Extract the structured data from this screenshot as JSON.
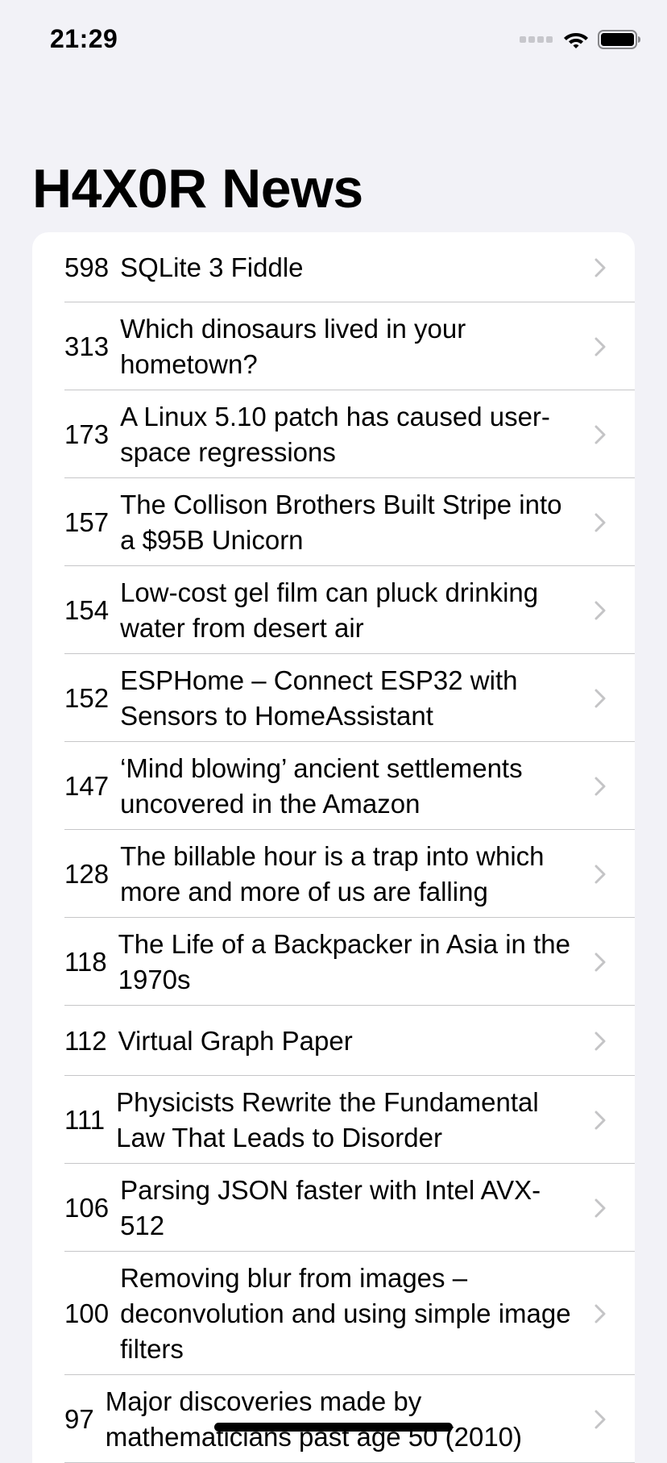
{
  "status_bar": {
    "time": "21:29"
  },
  "nav": {
    "title": "H4X0R News"
  },
  "colors": {
    "background": "#f2f2f7",
    "list_background": "#ffffff",
    "separator": "#c6c6c8",
    "chevron": "#c4c4c6",
    "text": "#000000"
  },
  "icons": {
    "row_disclosure": "chevron-right-icon",
    "status": [
      "cellular-signal-icon",
      "wifi-icon",
      "battery-icon"
    ]
  },
  "stories": [
    {
      "score": "598",
      "title": "SQLite 3 Fiddle",
      "lines": 1
    },
    {
      "score": "313",
      "title": "Which dinosaurs lived in your hometown?",
      "lines": 2
    },
    {
      "score": "173",
      "title": "A Linux 5.10 patch has caused user-space regressions",
      "lines": 2
    },
    {
      "score": "157",
      "title": "The Collison Brothers Built Stripe into a $95B Unicorn",
      "lines": 2
    },
    {
      "score": "154",
      "title": "Low-cost gel film can pluck drinking water from desert air",
      "lines": 2
    },
    {
      "score": "152",
      "title": "ESPHome – Connect ESP32 with Sensors to HomeAssistant",
      "lines": 2
    },
    {
      "score": "147",
      "title": "‘Mind blowing’ ancient settlements uncovered in the Amazon",
      "lines": 2
    },
    {
      "score": "128",
      "title": "The billable hour is a trap into which more and more of us are falling",
      "lines": 2
    },
    {
      "score": "118",
      "title": "The Life of a Backpacker in Asia in the 1970s",
      "lines": 2
    },
    {
      "score": "112",
      "title": "Virtual Graph Paper",
      "lines": 1
    },
    {
      "score": "111",
      "title": "Physicists Rewrite the Fundamental Law That Leads to Disorder",
      "lines": 2
    },
    {
      "score": "106",
      "title": "Parsing JSON faster with Intel AVX-512",
      "lines": 2
    },
    {
      "score": "100",
      "title": "Removing blur from images – deconvolution and using simple image filters",
      "lines": 3
    },
    {
      "score": "97",
      "title": "Major discoveries made by mathematicians past age 50 (2010)",
      "lines": 2
    }
  ]
}
